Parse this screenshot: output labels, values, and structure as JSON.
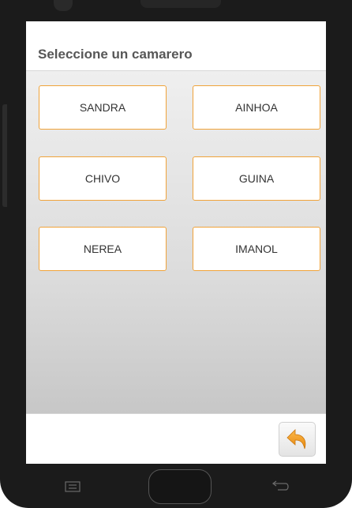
{
  "header": {
    "title": "Seleccione un camarero"
  },
  "waiters": [
    "SANDRA",
    "AINHOA",
    "CHIVO",
    "GUINA",
    "NEREA",
    "IMANOL"
  ],
  "icons": {
    "back": "undo-arrow-icon",
    "nav_menu": "menu-icon",
    "nav_home": "home-button",
    "nav_back": "back-icon"
  },
  "colors": {
    "accent": "#f0a33a",
    "back_arrow": "#f19a1c",
    "title": "#575757"
  }
}
